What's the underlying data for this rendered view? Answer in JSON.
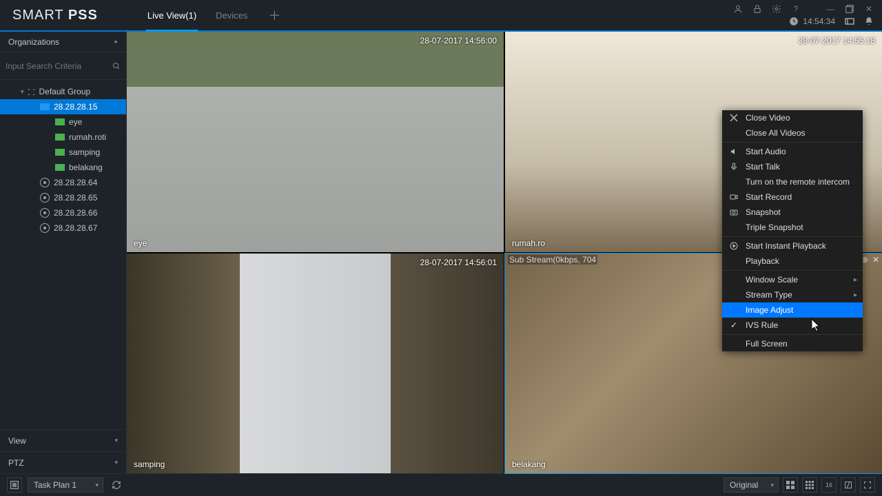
{
  "app": {
    "logo1": "SMART ",
    "logo2": "PSS"
  },
  "header": {
    "tabs": [
      {
        "label": "Live View(1)",
        "active": true
      },
      {
        "label": "Devices",
        "active": false
      }
    ],
    "clock": "14:54:34"
  },
  "sidebar": {
    "orgTitle": "Organizations",
    "searchPlaceholder": "Input Search Criteria",
    "tree": {
      "group": "Default Group",
      "device": "28.28.28.15",
      "channels": [
        "eye",
        "rumah.roti",
        "samping",
        "belakang"
      ],
      "nvrs": [
        "28.28.28.64",
        "28.28.28.65",
        "28.28.28.66",
        "28.28.28.67"
      ]
    },
    "viewLabel": "View",
    "ptzLabel": "PTZ"
  },
  "cams": [
    {
      "ts": "28-07-2017  14:56:00",
      "label": "eye"
    },
    {
      "ts": "28-07-2017  14:55:18",
      "label": "rumah.ro"
    },
    {
      "ts": "28-07-2017  14:56:01",
      "label": "samping"
    },
    {
      "ts": "",
      "label": "belakang",
      "stream": "Sub Stream(0kbps, 704"
    }
  ],
  "ctx": {
    "items": [
      {
        "t": "Close Video",
        "icon": "close"
      },
      {
        "t": "Close All Videos"
      },
      {
        "sep": true
      },
      {
        "t": "Start Audio",
        "icon": "audio"
      },
      {
        "t": "Start Talk",
        "icon": "mic"
      },
      {
        "t": "Turn on the remote intercom"
      },
      {
        "t": "Start Record",
        "icon": "rec"
      },
      {
        "t": "Snapshot",
        "icon": "cam"
      },
      {
        "t": "Triple Snapshot"
      },
      {
        "sep": true
      },
      {
        "t": "Start Instant Playback",
        "icon": "play"
      },
      {
        "t": "Playback"
      },
      {
        "sep": true
      },
      {
        "t": "Window Scale",
        "sub": true
      },
      {
        "t": "Stream Type",
        "sub": true
      },
      {
        "t": "Image Adjust",
        "hl": true
      },
      {
        "t": "IVS Rule",
        "chk": true
      },
      {
        "sep": true
      },
      {
        "t": "Full Screen"
      }
    ]
  },
  "bottom": {
    "task": "Task Plan 1",
    "scale": "Original",
    "layout16": "16"
  }
}
